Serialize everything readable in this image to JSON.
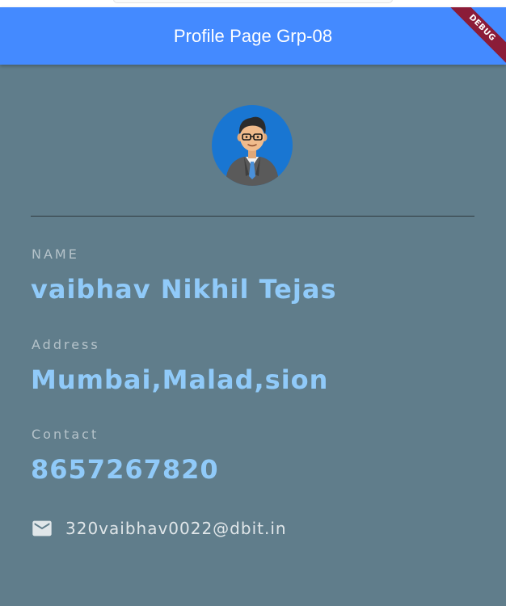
{
  "app_bar": {
    "title": "Profile Page Grp-08",
    "debug_banner": "DEBUG",
    "color": "#448aff"
  },
  "profile": {
    "avatar_icon": "cartoon-man-avatar-icon",
    "fields": [
      {
        "label": "NAME",
        "value": "vaibhav Nikhil Tejas"
      },
      {
        "label": "Address",
        "value": "Mumbai,Malad,sion"
      },
      {
        "label": "Contact",
        "value": "8657267820"
      }
    ],
    "email": "320vaibhav0022@dbit.in",
    "email_icon": "mail-icon"
  },
  "colors": {
    "background": "#607d8b",
    "value_text": "#90caf9",
    "avatar_bg": "#1976d2"
  }
}
